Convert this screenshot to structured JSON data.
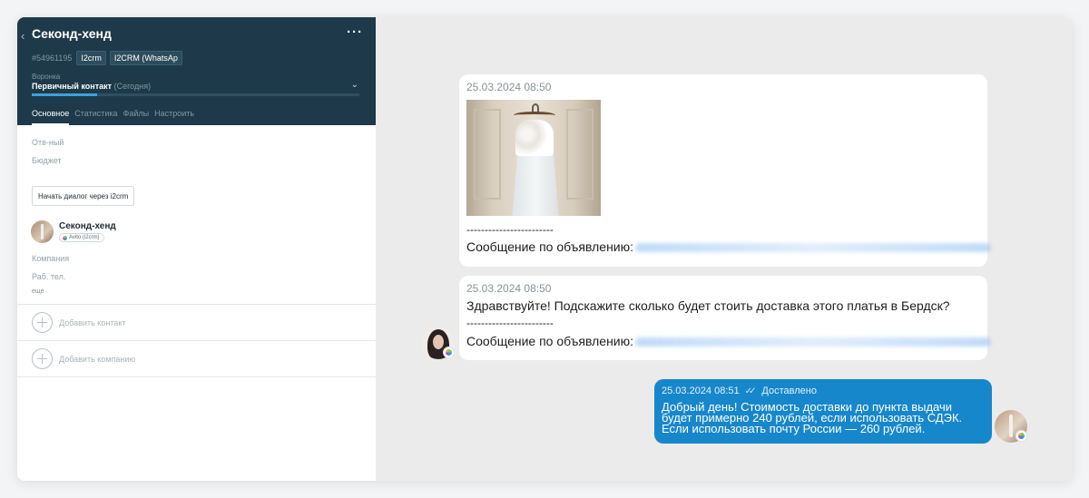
{
  "lead": {
    "back_icon": "chevron-left-icon",
    "title": "Секонд-хенд",
    "menu_label": "···",
    "id": "#54961195",
    "tags": [
      "I2crm",
      "I2CRM (WhatsAp"
    ],
    "pipeline_label": "Воронка",
    "stage": "Первичный контакт",
    "stage_when": "(Сегодня)",
    "stage_progress": 0.2,
    "tabs": [
      "Основное",
      "Статистика",
      "Файлы",
      "Настроить"
    ],
    "fields": {
      "responsible": "Отв-ный",
      "budget": "Бюджет"
    },
    "start_dialog_button": "Начать диалог через i2crm",
    "contact": {
      "name": "Секонд-хенд",
      "badge": "Avito (i2crm)"
    },
    "contact_fields": {
      "company": "Компания",
      "work_phone": "Раб. тел.",
      "more": "еще"
    },
    "add_contact": "Добавить контакт",
    "add_company": "Добавить компанию"
  },
  "chat": {
    "messages": [
      {
        "timestamp": "25.03.2024 08:50",
        "separator": "------------------------",
        "listing_label": "Сообщение по объявлению:"
      },
      {
        "timestamp": "25.03.2024 08:50",
        "text": "Здравствуйте! Подскажите сколько будет стоить доставка этого платья в Бердск?",
        "separator": "------------------------",
        "listing_label": "Сообщение по объявлению:"
      }
    ],
    "outgoing": {
      "timestamp": "25.03.2024 08:51",
      "status": "Доставлено",
      "text": "Добрый день! Стоимость доставки до пункта выдачи будет примерно 240 рублей, если использовать СДЭК. Если использовать почту России — 260 рублей."
    }
  },
  "colors": {
    "header_bg": "#1e3a4a",
    "accent_blue": "#1787cc",
    "progress": "#3ea1dc"
  }
}
